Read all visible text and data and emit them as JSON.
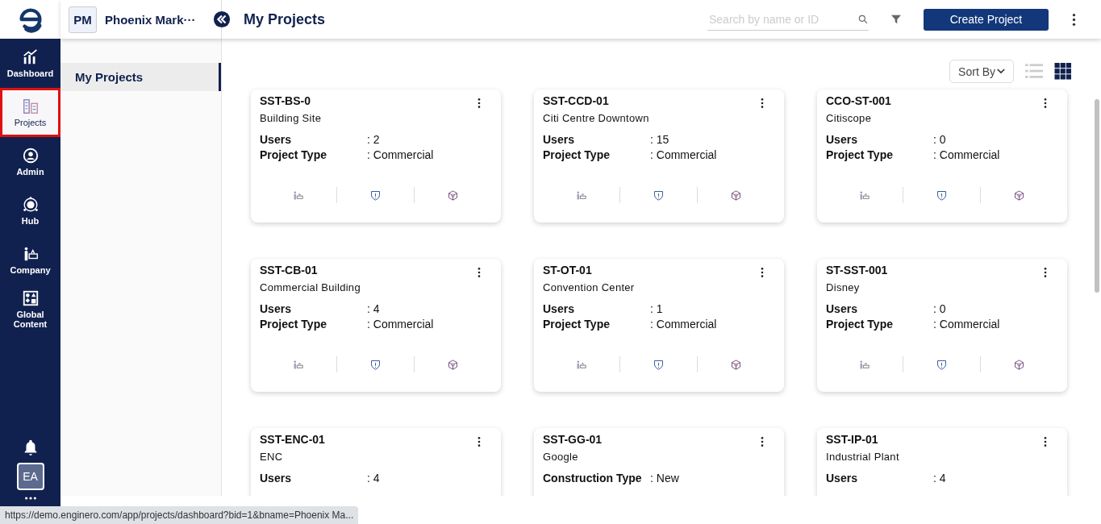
{
  "rail": {
    "items": [
      {
        "label": "Dashboard",
        "selected": false
      },
      {
        "label": "Projects",
        "selected": true
      },
      {
        "label": "Admin",
        "selected": false
      },
      {
        "label": "Hub",
        "selected": false
      },
      {
        "label": "Company",
        "selected": false
      },
      {
        "label": "Global Content",
        "selected": false
      }
    ],
    "avatar": "EA"
  },
  "header": {
    "org_badge": "PM",
    "org_name": "Phoenix Mark···",
    "title": "My Projects",
    "search": {
      "placeholder": "Search by name or ID"
    },
    "create_button": "Create Project"
  },
  "sidebar": {
    "items": [
      {
        "label": "My Projects",
        "selected": true
      }
    ]
  },
  "toolbar": {
    "sort": "Sort By",
    "views": [
      {
        "kind": "list",
        "selected": false
      },
      {
        "kind": "grid",
        "selected": true
      }
    ]
  },
  "projects": [
    {
      "code": "SST-BS-0",
      "name": "Building Site",
      "fields": [
        {
          "label": "Users",
          "value": ": 2"
        },
        {
          "label": "Project Type",
          "value": ": Commercial"
        }
      ]
    },
    {
      "code": "SST-CCD-01",
      "name": "Citi Centre Downtown",
      "fields": [
        {
          "label": "Users",
          "value": ": 15"
        },
        {
          "label": "Project Type",
          "value": ": Commercial"
        }
      ]
    },
    {
      "code": "CCO-ST-001",
      "name": "Citiscope",
      "fields": [
        {
          "label": "Users",
          "value": ": 0"
        },
        {
          "label": "Project Type",
          "value": ": Commercial"
        }
      ]
    },
    {
      "code": "SST-CB-01",
      "name": "Commercial Building",
      "fields": [
        {
          "label": "Users",
          "value": ": 4"
        },
        {
          "label": "Project Type",
          "value": ": Commercial"
        }
      ]
    },
    {
      "code": "ST-OT-01",
      "name": "Convention Center",
      "fields": [
        {
          "label": "Users",
          "value": ": 1"
        },
        {
          "label": "Project Type",
          "value": ": Commercial"
        }
      ]
    },
    {
      "code": "ST-SST-001",
      "name": "Disney",
      "fields": [
        {
          "label": "Users",
          "value": ": 0"
        },
        {
          "label": "Project Type",
          "value": ": Commercial"
        }
      ]
    },
    {
      "code": "SST-ENC-01",
      "name": "ENC",
      "fields": [
        {
          "label": "Users",
          "value": ": 4"
        }
      ]
    },
    {
      "code": "SST-GG-01",
      "name": "Google",
      "fields": [
        {
          "label": "Construction Type",
          "value": ": New"
        }
      ]
    },
    {
      "code": "SST-IP-01",
      "name": "Industrial Plant",
      "fields": [
        {
          "label": "Users",
          "value": ": 4"
        }
      ]
    }
  ],
  "status_url": "https://demo.enginero.com/app/projects/dashboard?bid=1&bname=Phoenix Ma..."
}
